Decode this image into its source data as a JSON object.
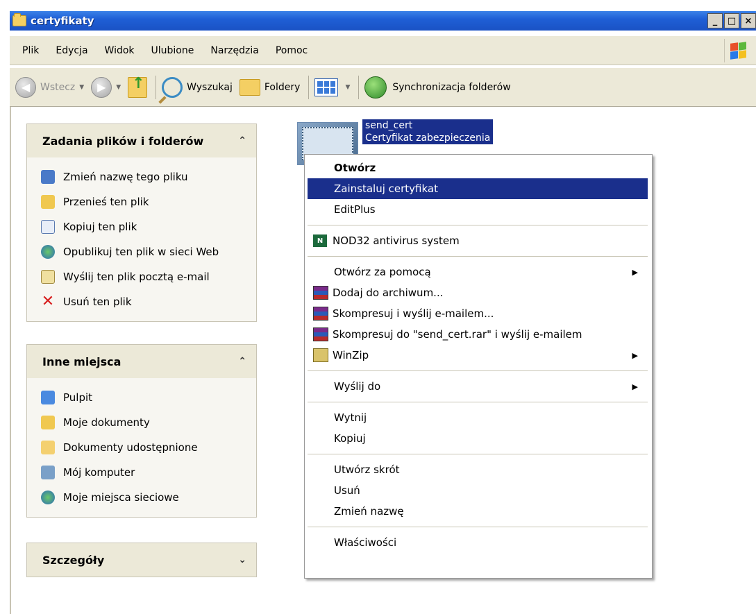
{
  "window": {
    "title": "certyfikaty",
    "minimize": "_",
    "maximize": "□",
    "close": "×"
  },
  "menubar": [
    "Plik",
    "Edycja",
    "Widok",
    "Ulubione",
    "Narzędzia",
    "Pomoc"
  ],
  "toolbar": {
    "back": "Wstecz",
    "search": "Wyszukaj",
    "folders": "Foldery",
    "sync": "Synchronizacja folderów"
  },
  "panes": {
    "tasks": {
      "title": "Zadania plików i folderów",
      "items": [
        "Zmień nazwę tego pliku",
        "Przenieś ten plik",
        "Kopiuj ten plik",
        "Opublikuj ten plik w sieci Web",
        "Wyślij ten plik pocztą e-mail",
        "Usuń ten plik"
      ]
    },
    "places": {
      "title": "Inne miejsca",
      "items": [
        "Pulpit",
        "Moje dokumenty",
        "Dokumenty udostępnione",
        "Mój komputer",
        "Moje miejsca sieciowe"
      ]
    },
    "details": {
      "title": "Szczegóły"
    }
  },
  "file": {
    "name": "send_cert",
    "type": "Certyfikat zabezpieczenia"
  },
  "context_menu": {
    "open": "Otwórz",
    "install": "Zainstaluj certyfikat",
    "editplus": "EditPlus",
    "nod32": "NOD32 antivirus system",
    "open_with": "Otwórz za pomocą",
    "add_archive": "Dodaj do archiwum...",
    "compress_email": "Skompresuj i wyślij e-mailem...",
    "compress_rar_email": "Skompresuj do \"send_cert.rar\" i wyślij e-mailem",
    "winzip": "WinZip",
    "send_to": "Wyślij do",
    "cut": "Wytnij",
    "copy": "Kopiuj",
    "shortcut": "Utwórz skrót",
    "delete": "Usuń",
    "rename": "Zmień nazwę",
    "properties": "Właściwości"
  }
}
